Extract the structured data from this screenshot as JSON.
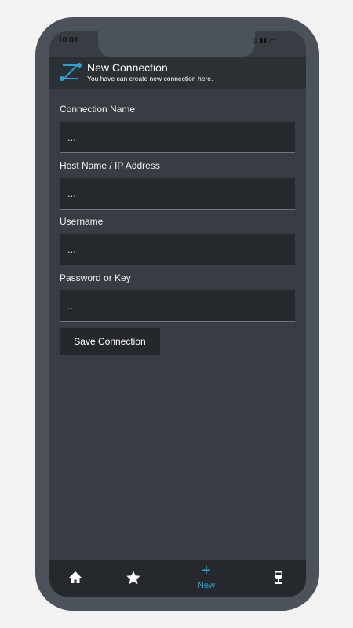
{
  "status_bar": {
    "time": "10:01",
    "indicators": "▯ ▮▮ ▭"
  },
  "header": {
    "title": "New Connection",
    "subtitle": "You have can create new connection here."
  },
  "form": {
    "fields": [
      {
        "label": "Connection Name",
        "value": "...",
        "placeholder": "..."
      },
      {
        "label": "Host Name / IP Address",
        "value": "...",
        "placeholder": "..."
      },
      {
        "label": "Username",
        "value": "...",
        "placeholder": "..."
      },
      {
        "label": "Password or Key",
        "value": "...",
        "placeholder": "..."
      }
    ],
    "save_label": "Save Connection"
  },
  "bottom_nav": {
    "items": [
      {
        "icon": "home-icon",
        "label": ""
      },
      {
        "icon": "star-icon",
        "label": ""
      },
      {
        "icon": "plus-icon",
        "label": "New",
        "active": true,
        "symbol": "+"
      },
      {
        "icon": "wine-glass-icon",
        "label": ""
      }
    ]
  },
  "colors": {
    "accent": "#29a3d6",
    "background": "#373d43",
    "appbar": "#2b3035",
    "field": "#25292d"
  }
}
